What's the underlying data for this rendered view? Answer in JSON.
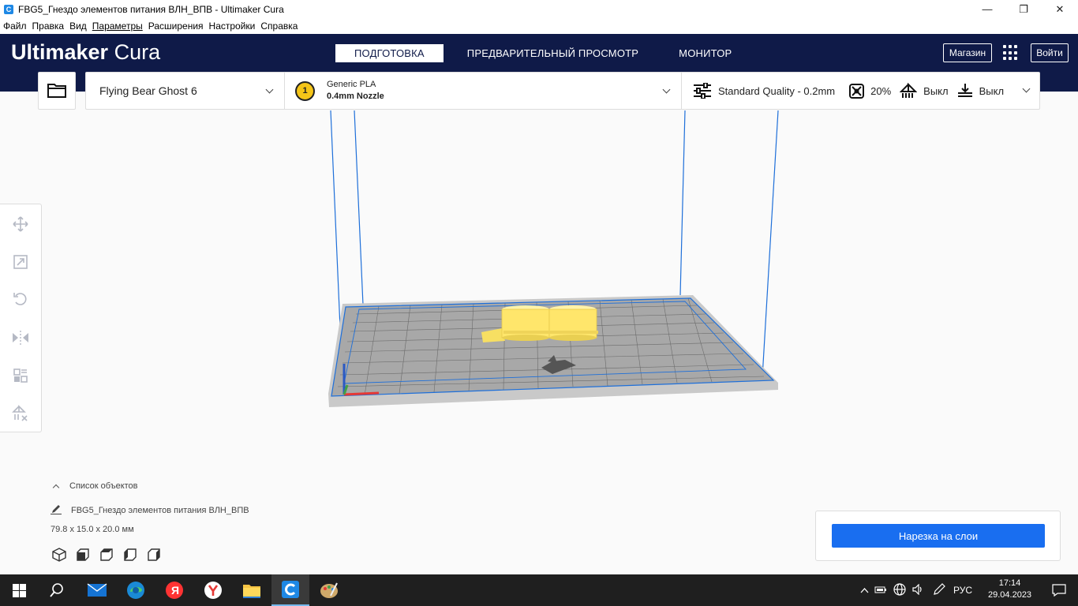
{
  "window": {
    "title": "FBG5_Гнездо элементов питания ВЛН_ВПВ - Ultimaker Cura",
    "minimize": "—",
    "maximize": "❐",
    "close": "✕"
  },
  "menu": [
    "Файл",
    "Правка",
    "Вид",
    "Параметры",
    "Расширения",
    "Настройки",
    "Справка"
  ],
  "header": {
    "logo_bold": "Ultimaker",
    "logo_light": "Cura",
    "stages": [
      "ПОДГОТОВКА",
      "ПРЕДВАРИТЕЛЬНЫЙ ПРОСМОТР",
      "МОНИТОР"
    ],
    "active_stage": "ПОДГОТОВКА",
    "marketplace": "Магазин",
    "signin": "Войти"
  },
  "printer": {
    "name": "Flying Bear Ghost 6",
    "extruder_number": "1",
    "material": "Generic PLA",
    "nozzle": "0.4mm Nozzle",
    "quality": "Standard Quality - 0.2mm",
    "infill": "20%",
    "support": "Выкл",
    "adhesion": "Выкл"
  },
  "tools": [
    "move-icon",
    "scale-icon",
    "rotate-icon",
    "mirror-icon",
    "per-model-settings-icon",
    "support-blocker-icon"
  ],
  "objects": {
    "toggle_label": "Список объектов",
    "filename": "FBG5_Гнездо элементов питания ВЛН_ВПВ",
    "dimensions": "79.8 x 15.0 x 20.0 мм"
  },
  "slice": {
    "button": "Нарезка на слои"
  },
  "taskbar": {
    "lang": "РУС",
    "time": "17:14",
    "date": "29.04.2023"
  },
  "colors": {
    "header": "#0f1a48",
    "accent": "#196ef0",
    "model": "#ffe66b",
    "build_volume": "#1e6fd9"
  }
}
